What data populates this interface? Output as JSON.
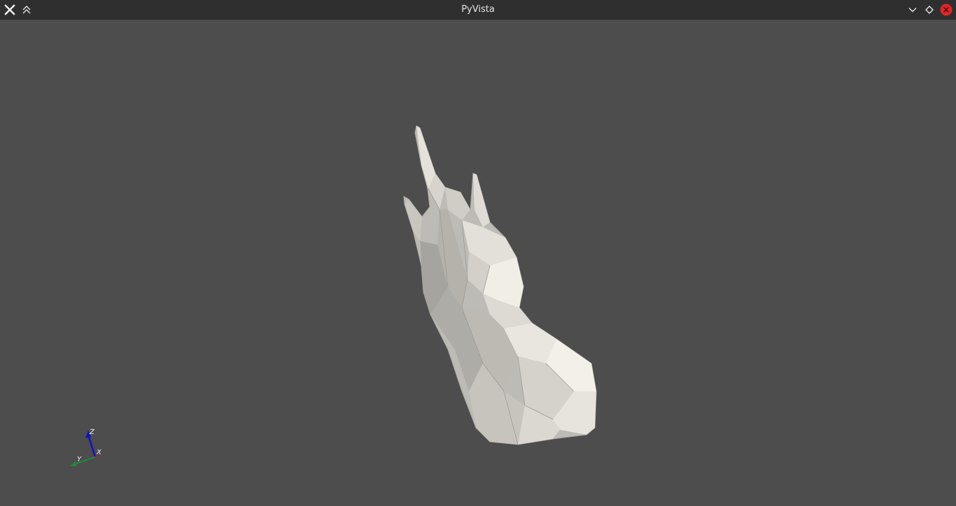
{
  "window": {
    "title": "PyVista",
    "buttons": {
      "app_menu_icon": "x-logo-icon",
      "keep_above_icon": "double-chevron-up-icon",
      "minimize_icon": "chevron-down-icon",
      "maximize_icon": "diamond-icon",
      "close_icon": "close-circle-icon"
    },
    "colors": {
      "titlebar": "#2f2f2f",
      "title_text": "#e6e6e6",
      "close_button": "#e0242a"
    }
  },
  "scene": {
    "background_color": "#4d4d4d",
    "mesh_color": "#e6e4dc",
    "orientation_widget": {
      "z_label": "Z",
      "x_label": "X",
      "y_label": "Y",
      "z_color": "#1010c8",
      "x_color": "#c81010",
      "y_color": "#1f8a3a"
    }
  }
}
